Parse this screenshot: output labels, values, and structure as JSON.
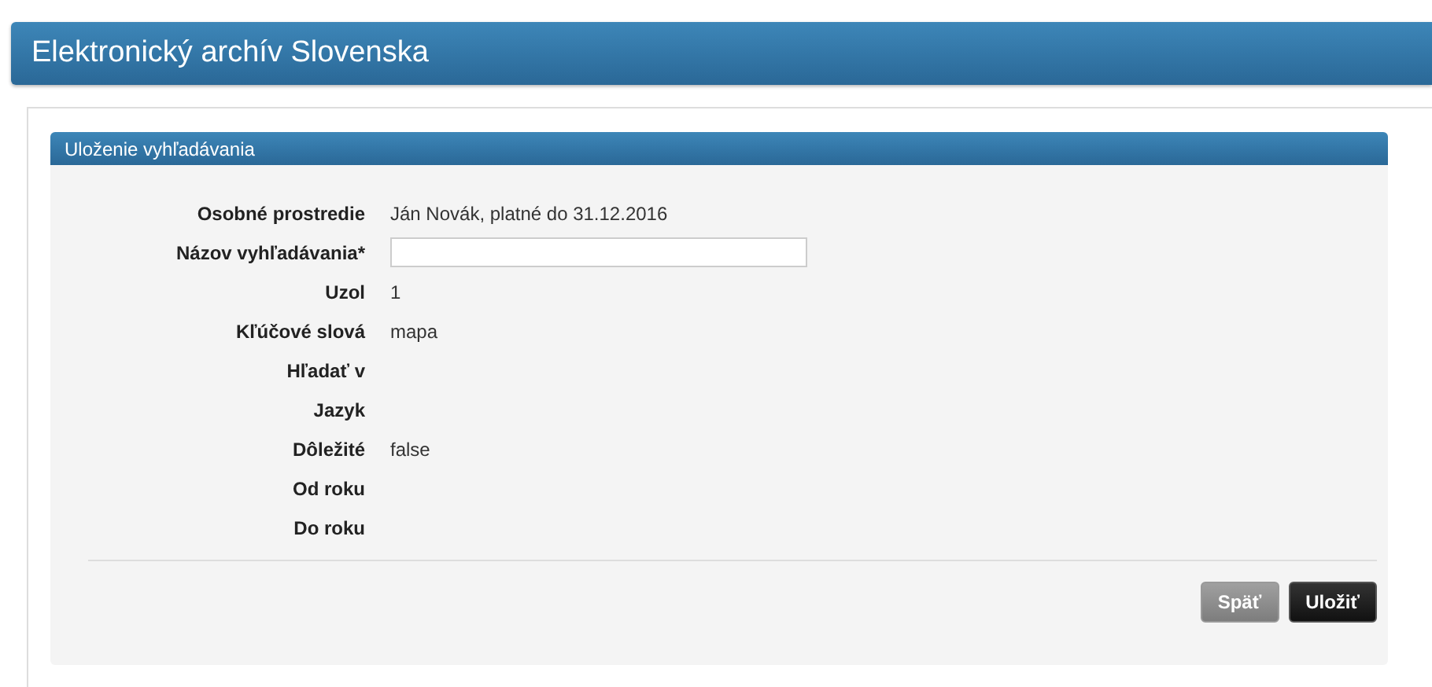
{
  "header": {
    "title": "Elektronický archív Slovenska"
  },
  "panel": {
    "title": "Uloženie vyhľadávania",
    "fields": [
      {
        "kind": "text",
        "label": "Osobné prostredie",
        "value": "Ján Novák, platné do 31.12.2016"
      },
      {
        "kind": "input",
        "label": "Názov vyhľadávania*"
      },
      {
        "kind": "text",
        "label": "Uzol",
        "value": "1"
      },
      {
        "kind": "text",
        "label": "Kľúčové slová",
        "value": "mapa"
      },
      {
        "kind": "text",
        "label": "Hľadať v"
      },
      {
        "kind": "text",
        "label": "Jazyk"
      },
      {
        "kind": "text",
        "label": "Dôležité",
        "value": "false"
      },
      {
        "kind": "text",
        "label": "Od roku"
      },
      {
        "kind": "text",
        "label": "Do roku"
      }
    ],
    "buttons": [
      {
        "kind": "secondary",
        "label": "Späť"
      },
      {
        "kind": "primary",
        "label": "Uložiť"
      }
    ]
  }
}
